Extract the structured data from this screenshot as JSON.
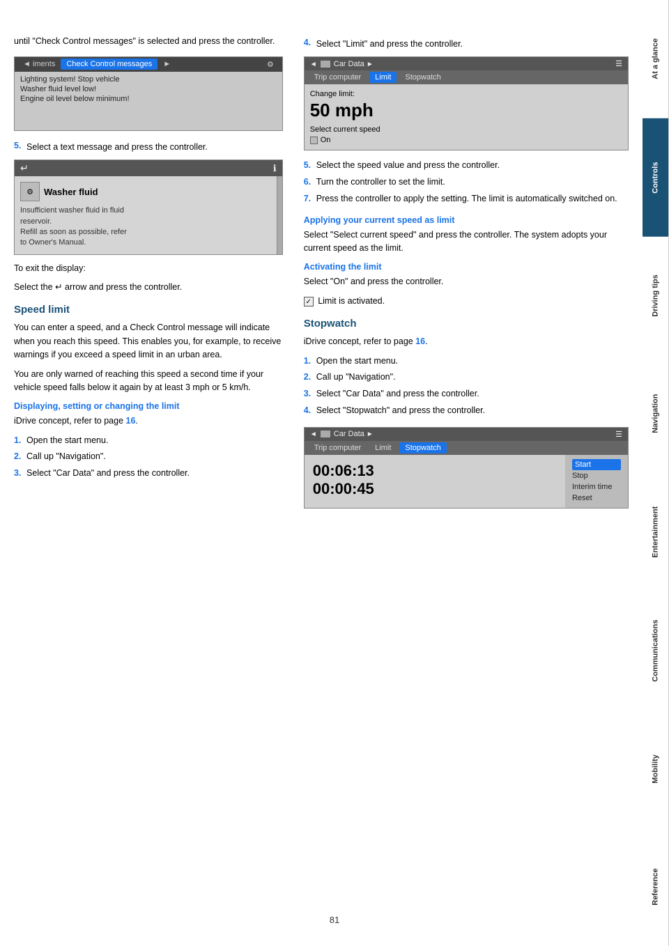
{
  "sidebar": {
    "tabs": [
      {
        "label": "At a glance",
        "active": false
      },
      {
        "label": "Controls",
        "active": true
      },
      {
        "label": "Driving tips",
        "active": false
      },
      {
        "label": "Navigation",
        "active": false
      },
      {
        "label": "Entertainment",
        "active": false
      },
      {
        "label": "Communications",
        "active": false
      },
      {
        "label": "Mobility",
        "active": false
      },
      {
        "label": "Reference",
        "active": false
      }
    ]
  },
  "left": {
    "intro_text": "until \"Check Control messages\" is selected and press the controller.",
    "screen1": {
      "tab_left": "◄ iments",
      "tab_selected": "Check Control messages",
      "tab_right": "►",
      "icon": "⚙",
      "items": [
        "Lighting system! Stop vehicle",
        "Washer fluid level low!",
        "Engine oil level below minimum!"
      ]
    },
    "step5_intro": "5.",
    "step5_text": "Select a text message and press the controller.",
    "screen2": {
      "back_arrow": "↵",
      "info_icon": "ℹ",
      "washer_icon": "⚙",
      "title": "Washer fluid",
      "line1": "Insufficient washer fluid in fluid",
      "line2": "reservoir.",
      "line3": "Refill as soon as possible, refer",
      "line4": "to Owner's Manual."
    },
    "exit_text1": "To exit the display:",
    "exit_text2": "Select the ↵ arrow and press the controller.",
    "speed_limit_heading": "Speed limit",
    "speed_limit_body1": "You can enter a speed, and a Check Control message will indicate when you reach this speed. This enables you, for example, to receive warnings if you exceed a speed limit in an urban area.",
    "speed_limit_body2": "You are only warned of reaching this speed a second time if your vehicle speed falls below it again by at least 3 mph or 5 km/h.",
    "displaying_heading": "Displaying, setting or changing the limit",
    "idrive_ref": "iDrive concept, refer to page 16.",
    "steps_left": [
      {
        "num": "1.",
        "text": "Open the start menu."
      },
      {
        "num": "2.",
        "text": "Call up \"Navigation\"."
      },
      {
        "num": "3.",
        "text": "Select \"Car Data\" and press the controller."
      }
    ]
  },
  "right": {
    "step4_num": "4.",
    "step4_text": "Select \"Limit\" and press the controller.",
    "car_data_header": "◄ Car Data ►",
    "screen_limit": {
      "tab_trip": "Trip computer",
      "tab_limit": "Limit",
      "tab_stopwatch": "Stopwatch",
      "change_limit_label": "Change limit:",
      "limit_value": "50 mph",
      "select_label": "Select current speed",
      "checkbox_label": "On"
    },
    "step5_num": "5.",
    "step5_text": "Select the speed value and press the controller.",
    "step6_num": "6.",
    "step6_text": "Turn the controller to set the limit.",
    "step7_num": "7.",
    "step7_text": "Press the controller to apply the setting. The limit is automatically switched on.",
    "applying_heading": "Applying your current speed as limit",
    "applying_text": "Select \"Select current speed\" and press the controller. The system adopts your current speed as the limit.",
    "activating_heading": "Activating the limit",
    "activating_text": "Select \"On\" and press the controller.",
    "limit_activated": "Limit is activated.",
    "stopwatch_heading": "Stopwatch",
    "idrive_ref2": "iDrive concept, refer to page 16.",
    "steps_right": [
      {
        "num": "1.",
        "text": "Open the start menu."
      },
      {
        "num": "2.",
        "text": "Call up \"Navigation\"."
      },
      {
        "num": "3.",
        "text": "Select \"Car Data\" and press the controller."
      },
      {
        "num": "4.",
        "text": "Select \"Stopwatch\" and press the controller."
      }
    ],
    "sw_screen": {
      "header": "◄ Car Data►",
      "tab_trip": "Trip computer",
      "tab_limit": "Limit",
      "tab_stopwatch": "Stopwatch",
      "time1": "00:06:13",
      "time2": "00:00:45",
      "menu_items": [
        "Start",
        "Stop",
        "Interim time",
        "Reset"
      ]
    }
  },
  "page_number": "81"
}
